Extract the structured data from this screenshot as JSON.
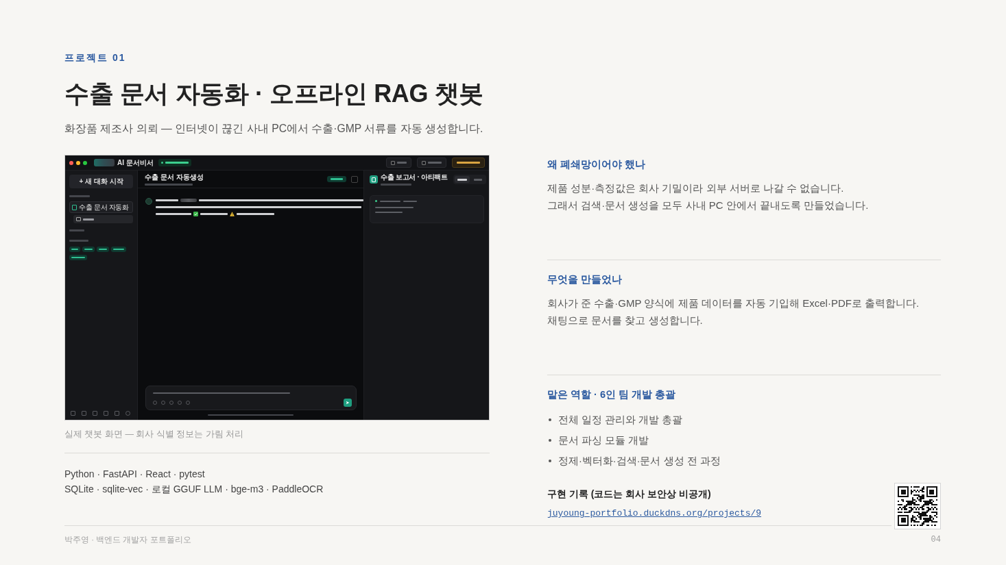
{
  "header": {
    "eyebrow": "프로젝트 01",
    "title": "수출 문서 자동화 · 오프라인 RAG 챗봇",
    "subtitle": "화장품 제조사 의뢰 — 인터넷이 끊긴 사내 PC에서 수출·GMP 서류를 자동 생성합니다."
  },
  "chat_screen": {
    "app_title": "AI 문서비서",
    "new_chat_button": "+ 새 대화 시작",
    "sidebar_items": [
      {
        "label": "수출 문서 자동화",
        "selected": true
      }
    ],
    "chat_title": "수출 문서 자동생성",
    "panel_title": "수출 보고서 · 아티팩트"
  },
  "screenshot_caption": "실제 챗봇 화면 — 회사 식별 정보는 가림 처리",
  "tech_stack": [
    "Python · FastAPI · React · pytest",
    "SQLite · sqlite-vec · 로컬 GGUF LLM · bge-m3 · PaddleOCR"
  ],
  "sections": [
    {
      "kind": "paragraph",
      "heading": "왜 폐쇄망이어야 했나",
      "lines": [
        "제품 성분·측정값은 회사 기밀이라 외부 서버로 나갈 수 없습니다.",
        "그래서 검색·문서 생성을 모두 사내 PC 안에서 끝내도록 만들었습니다."
      ]
    },
    {
      "kind": "paragraph",
      "heading": "무엇을 만들었나",
      "lines": [
        "회사가 준 수출·GMP 양식에 제품 데이터를 자동 기입해 Excel·PDF로 출력합니다.",
        "채팅으로 문서를 찾고 생성합니다."
      ]
    },
    {
      "kind": "bullets",
      "heading": "맡은 역할 · 6인 팀 개발 총괄",
      "lines": [
        "전체 일정 관리와 개발 총괄",
        "문서 파싱 모듈 개발",
        "정제·벡터화·검색·문서 생성 전 과정"
      ]
    }
  ],
  "record": {
    "heading": "구현 기록 (코드는 회사 보안상 비공개)",
    "link": "juyoung-portfolio.duckdns.org/projects/9"
  },
  "footer": {
    "author": "박주영 · 백엔드 개발자 포트폴리오",
    "page": "04"
  }
}
